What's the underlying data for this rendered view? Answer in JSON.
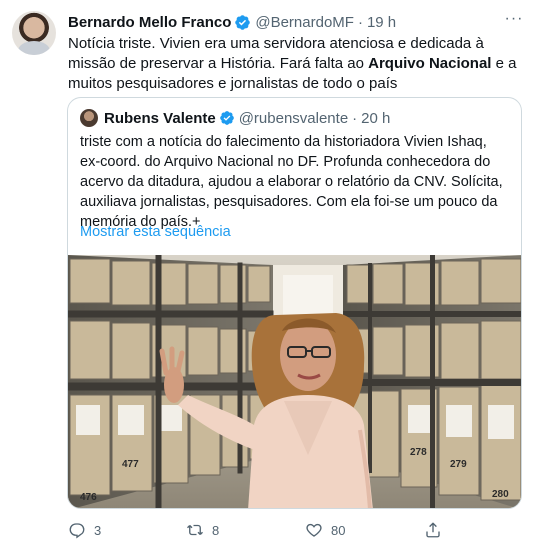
{
  "tweet": {
    "author_name": "Bernardo Mello Franco",
    "author_handle": "@BernardoMF",
    "separator": "·",
    "time": "19 h",
    "text_part1": "Notícia triste. Vivien era uma servidora atenciosa e dedicada à missão de preservar a História. Fará falta ao ",
    "text_bold": "Arquivo Nacional",
    "text_part2": " e a muitos pesquisadores e jornalistas de todo o país"
  },
  "quoted": {
    "author_name": "Rubens Valente",
    "author_handle": "@rubensvalente",
    "separator": "·",
    "time": "20 h",
    "text": "triste com a notícia do falecimento da historiadora Vivien Ishaq, ex-coord. do Arquivo Nacional no DF. Profunda conhecedora do acervo da ditadura, ajudou a elaborar o relatório da CNV. Solícita, auxiliava jornalistas, pesquisadores. Com ela foi-se um pouco da memória do país.+",
    "show_thread": "Mostrar esta sequência",
    "box_labels": [
      "476",
      "477",
      "278",
      "279",
      "280"
    ]
  },
  "actions": {
    "replies": "3",
    "retweets": "8",
    "likes": "80"
  },
  "icons": {
    "verified": "verified-badge-icon",
    "more": "more-options-icon",
    "reply": "reply-icon",
    "retweet": "retweet-icon",
    "like": "heart-icon",
    "share": "share-icon"
  },
  "colors": {
    "accent": "#1d9bf0",
    "secondary_text": "#536471",
    "border": "#cfd9de"
  }
}
